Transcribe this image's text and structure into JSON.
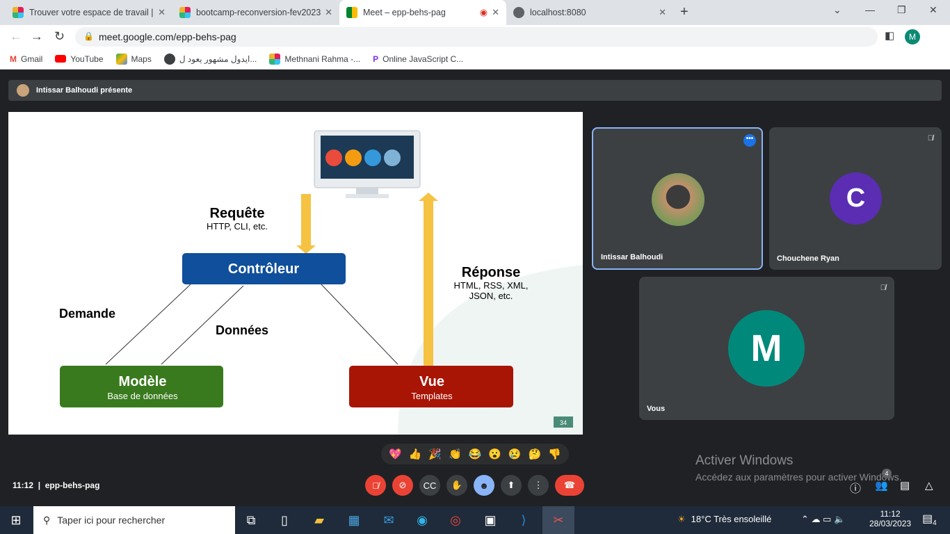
{
  "browser": {
    "tabs": [
      {
        "title": "Trouver votre espace de travail | S"
      },
      {
        "title": "bootcamp-reconversion-fev2023"
      },
      {
        "title": "Meet – epp-behs-pag"
      },
      {
        "title": "localhost:8080"
      }
    ],
    "url": "meet.google.com/epp-behs-pag",
    "profile_initial": "M",
    "bookmarks": [
      "Gmail",
      "YouTube",
      "Maps",
      "ايدول مشهور يعود ل...",
      "Methnani Rahma -...",
      "Online JavaScript C..."
    ]
  },
  "meet": {
    "presenting": "Intissar Balhoudi présente",
    "slide": {
      "requete": "Requête",
      "requete_sub": "HTTP, CLI, etc.",
      "controleur": "Contrôleur",
      "reponse": "Réponse",
      "reponse_sub1": "HTML, RSS, XML,",
      "reponse_sub2": "JSON, etc.",
      "demande": "Demande",
      "donnees": "Données",
      "modele": "Modèle",
      "modele_sub": "Base de données",
      "vue": "Vue",
      "vue_sub": "Templates",
      "page": "34"
    },
    "participants": [
      {
        "name": "Intissar Balhoudi",
        "initial": ""
      },
      {
        "name": "Chouchene Ryan",
        "initial": "C"
      },
      {
        "name": "Vous",
        "initial": "M"
      }
    ],
    "reactions": [
      "💖",
      "👍",
      "🎉",
      "👏",
      "😂",
      "😮",
      "😢",
      "🤔",
      "👎"
    ],
    "time": "11:12",
    "meeting_code": "epp-behs-pag",
    "people_count": "4",
    "watermark_title": "Activer Windows",
    "watermark_sub": "Accédez aux paramètres pour activer Windows."
  },
  "taskbar": {
    "search": "Taper ici pour rechercher",
    "weather": "18°C  Très ensoleillé",
    "time": "11:12",
    "date": "28/03/2023",
    "notifications": "4"
  }
}
